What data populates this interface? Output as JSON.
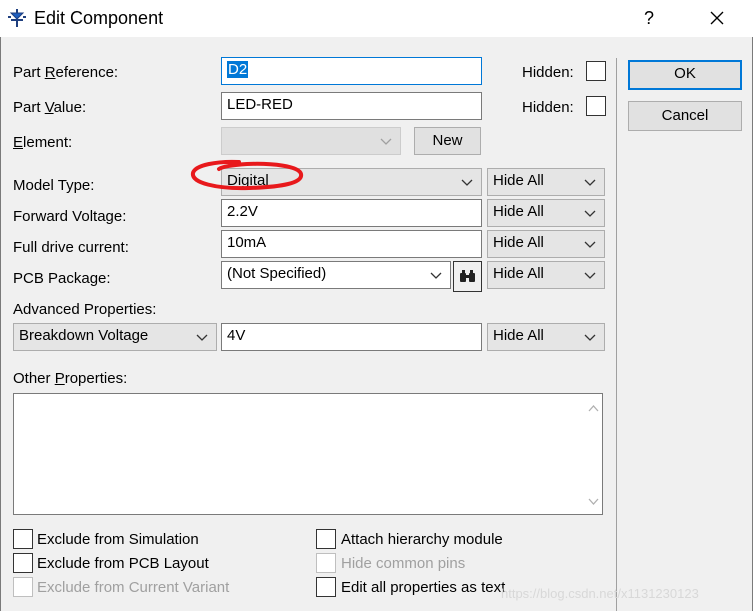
{
  "window": {
    "title": "Edit Component",
    "help": "?"
  },
  "fields": {
    "part_reference": {
      "label_pre": "Part ",
      "label_ul": "R",
      "label_post": "eference:",
      "value": "D2"
    },
    "part_value": {
      "label_pre": "Part ",
      "label_ul": "V",
      "label_post": "alue:",
      "value": "LED-RED"
    },
    "element": {
      "label_ul": "E",
      "label_post": "lement:",
      "value": ""
    },
    "model_type": {
      "label": "Model Type:",
      "value": "Digital"
    },
    "forward_voltage": {
      "label": "Forward Voltage:",
      "value": "2.2V"
    },
    "full_drive_current": {
      "label": "Full drive current:",
      "value": "10mA"
    },
    "pcb_package": {
      "label": "PCB Package:",
      "value": "(Not Specified)"
    },
    "advanced_properties": {
      "label": "Advanced Properties:",
      "property": "Breakdown Voltage",
      "value": "4V"
    },
    "other_properties": {
      "label_pre": "Other ",
      "label_ul": "P",
      "label_post": "roperties:",
      "value": ""
    }
  },
  "hidden_label": "Hidden:",
  "hide_all": "Hide All",
  "buttons": {
    "new": "New",
    "ok": "OK",
    "cancel": "Cancel"
  },
  "checkboxes": {
    "exclude_simulation": "Exclude from Simulation",
    "exclude_pcb": "Exclude from PCB Layout",
    "exclude_variant": "Exclude from Current Variant",
    "attach_hierarchy": "Attach hierarchy module",
    "hide_common_pins": "Hide common pins",
    "edit_as_text": "Edit all properties as text"
  },
  "watermark": "https://blog.csdn.net/x1131230123",
  "colors": {
    "accent": "#0078d7",
    "annotation": "#e8191c"
  }
}
